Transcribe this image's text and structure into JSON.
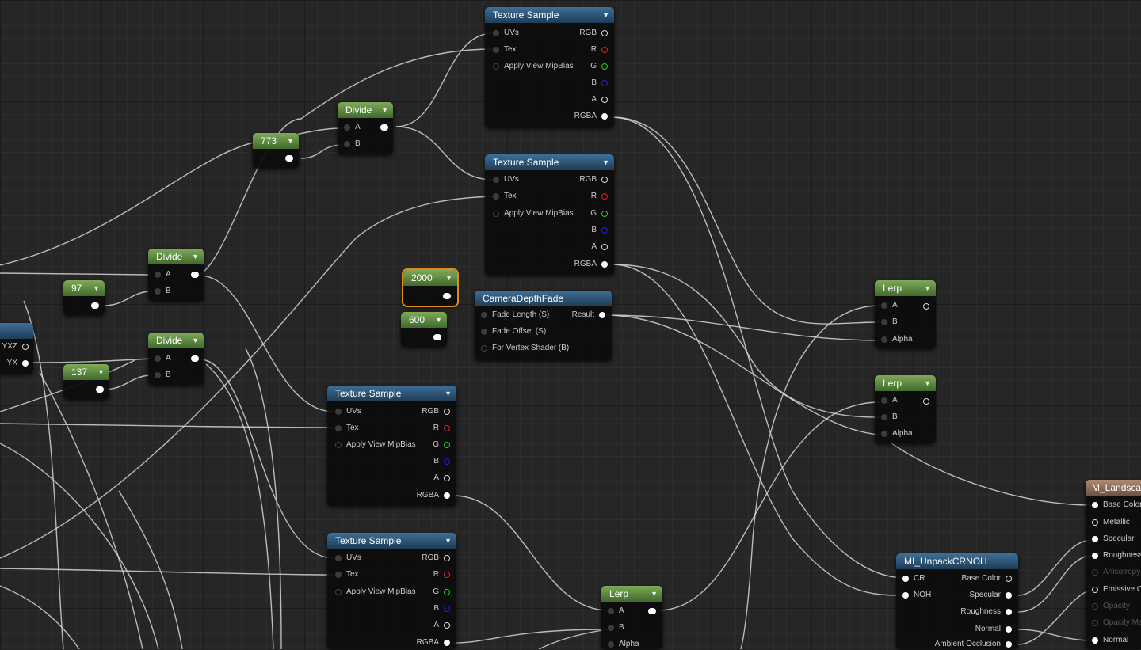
{
  "nodes": {
    "ts1": {
      "title": "Texture Sample",
      "inputs": [
        "UVs",
        "Tex",
        "Apply View MipBias"
      ],
      "outputs": [
        "RGB",
        "R",
        "G",
        "B",
        "A",
        "RGBA"
      ]
    },
    "ts2": {
      "title": "Texture Sample",
      "inputs": [
        "UVs",
        "Tex",
        "Apply View MipBias"
      ],
      "outputs": [
        "RGB",
        "R",
        "G",
        "B",
        "A",
        "RGBA"
      ]
    },
    "ts3": {
      "title": "Texture Sample",
      "inputs": [
        "UVs",
        "Tex",
        "Apply View MipBias"
      ],
      "outputs": [
        "RGB",
        "R",
        "G",
        "B",
        "A",
        "RGBA"
      ]
    },
    "ts4": {
      "title": "Texture Sample",
      "inputs": [
        "UVs",
        "Tex",
        "Apply View MipBias"
      ],
      "outputs": [
        "RGB",
        "R",
        "G",
        "B",
        "A",
        "RGBA"
      ]
    },
    "divide1": {
      "title": "Divide",
      "inputs": [
        "A",
        "B"
      ]
    },
    "divide2": {
      "title": "Divide",
      "inputs": [
        "A",
        "B"
      ]
    },
    "divide3": {
      "title": "Divide",
      "inputs": [
        "A",
        "B"
      ]
    },
    "const773": {
      "title": "773"
    },
    "const97": {
      "title": "97"
    },
    "const137": {
      "title": "137"
    },
    "const2000": {
      "title": "2000"
    },
    "const600": {
      "title": "600"
    },
    "cdf": {
      "title": "CameraDepthFade",
      "inputs": [
        "Fade Length (S)",
        "Fade Offset (S)",
        "For Vertex Shader (B)"
      ],
      "output": "Result"
    },
    "lerp1": {
      "title": "Lerp",
      "inputs": [
        "A",
        "B",
        "Alpha"
      ]
    },
    "lerp2": {
      "title": "Lerp",
      "inputs": [
        "A",
        "B",
        "Alpha"
      ]
    },
    "lerp3": {
      "title": "Lerp",
      "inputs": [
        "A",
        "B",
        "Alpha"
      ]
    },
    "unpack": {
      "title": "MI_UnpackCRNOH",
      "inputs": [
        "CR",
        "NOH"
      ],
      "outputs": [
        "Base Color",
        "Specular",
        "Roughness",
        "Normal",
        "Ambient Occlusion"
      ]
    },
    "result": {
      "title": "M_Landscape",
      "inputs": [
        "Base Color",
        "Metallic",
        "Specular",
        "Roughness",
        "Anisotropy",
        "Emissive Color",
        "Opacity",
        "Opacity Mask",
        "Normal"
      ]
    },
    "leftpartial": {
      "outputs": [
        "YXZ",
        "YX"
      ]
    }
  }
}
